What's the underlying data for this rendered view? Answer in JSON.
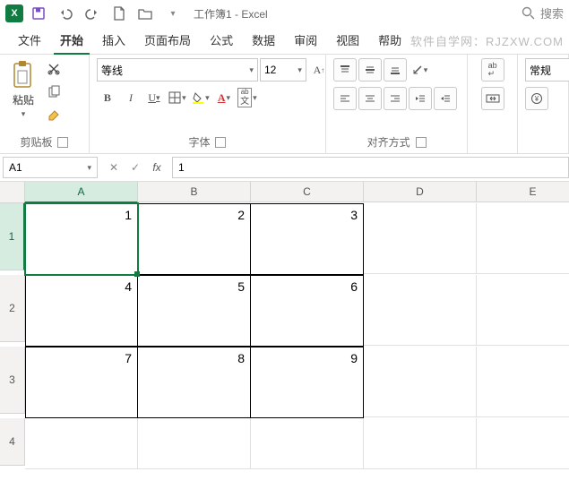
{
  "titlebar": {
    "doc_title": "工作簿1 - Excel",
    "search_placeholder": "搜索"
  },
  "tabs": {
    "items": [
      "文件",
      "开始",
      "插入",
      "页面布局",
      "公式",
      "数据",
      "审阅",
      "视图",
      "帮助"
    ],
    "active_index": 1,
    "watermark": "软件自学网：RJZXW.COM"
  },
  "ribbon": {
    "clipboard": {
      "paste_label": "粘贴",
      "group_label": "剪贴板"
    },
    "font": {
      "font_name": "等线",
      "font_size": "12",
      "bold": "B",
      "italic": "I",
      "underline": "U",
      "group_label": "字体"
    },
    "align": {
      "group_label": "对齐方式",
      "wrap": "ab"
    },
    "number": {
      "style_label": "常规"
    }
  },
  "name_box": "A1",
  "formula_value": "1",
  "grid": {
    "col_headers": [
      "A",
      "B",
      "C",
      "D",
      "E"
    ],
    "row_headers": [
      "1",
      "2",
      "3",
      "4"
    ],
    "active_cell": "A1",
    "rows": [
      {
        "cells": [
          "1",
          "2",
          "3",
          "",
          ""
        ]
      },
      {
        "cells": [
          "4",
          "5",
          "6",
          "",
          ""
        ]
      },
      {
        "cells": [
          "7",
          "8",
          "9",
          "",
          ""
        ]
      },
      {
        "cells": [
          "",
          "",
          "",
          "",
          ""
        ]
      }
    ]
  },
  "chart_data": {
    "type": "table",
    "columns": [
      "A",
      "B",
      "C"
    ],
    "rows": [
      "1",
      "2",
      "3"
    ],
    "values": [
      [
        1,
        2,
        3
      ],
      [
        4,
        5,
        6
      ],
      [
        7,
        8,
        9
      ]
    ]
  }
}
